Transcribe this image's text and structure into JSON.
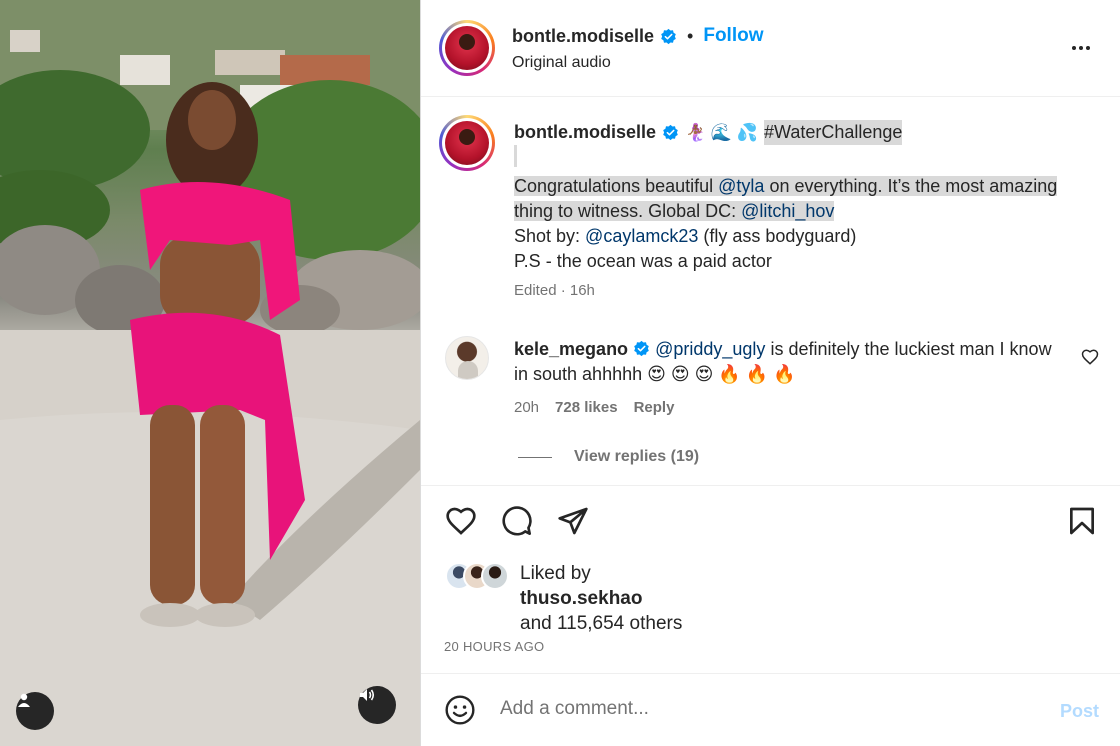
{
  "post": {
    "username": "bontle.modiselle",
    "follow_label": "Follow",
    "audio": "Original audio"
  },
  "caption": {
    "username": "bontle.modiselle",
    "emojis": "🧜🏾‍♀️ 🌊 💦",
    "hashtag": "#WaterChallenge",
    "line1_prefix": "Congratulations beautiful ",
    "mention1": "@tyla",
    "line1_rest": " on everything. It’s the most amazing thing to witness. Global DC: ",
    "mention2": "@litchi_hov",
    "shot_prefix": "Shot by: ",
    "mention3": "@caylamck23",
    "shot_rest": " (fly ass bodyguard)",
    "ps": "P.S - the ocean was a paid actor",
    "edited": "Edited · 16h"
  },
  "comment": {
    "username": "kele_megano",
    "mention": "@priddy_ugly",
    "text": " is definitely the luckiest man I know in south ahhhhh 😍 😍 😍 🔥 🔥 🔥",
    "time": "20h",
    "likes": "728 likes",
    "reply": "Reply",
    "view_replies": "View replies (19)"
  },
  "likes": {
    "liked_by_label": "Liked by",
    "liker": "thuso.sekhao",
    "others_text": "and 115,654 others"
  },
  "timestamp": "20 HOURS AGO",
  "comment_box": {
    "placeholder": "Add a comment...",
    "post_label": "Post"
  },
  "colors": {
    "accent": "#0095f6",
    "verified": "#0095f6",
    "post_disabled": "#b3dbff",
    "outfit_pink": "#f0167a"
  },
  "icons": {
    "media_user": "user-icon",
    "media_sound": "speaker-icon",
    "like": "heart-icon",
    "comment": "comment-bubble-icon",
    "share": "paper-plane-icon",
    "save": "bookmark-icon",
    "emoji": "smiley-icon",
    "more": "more-horizontal-icon"
  }
}
